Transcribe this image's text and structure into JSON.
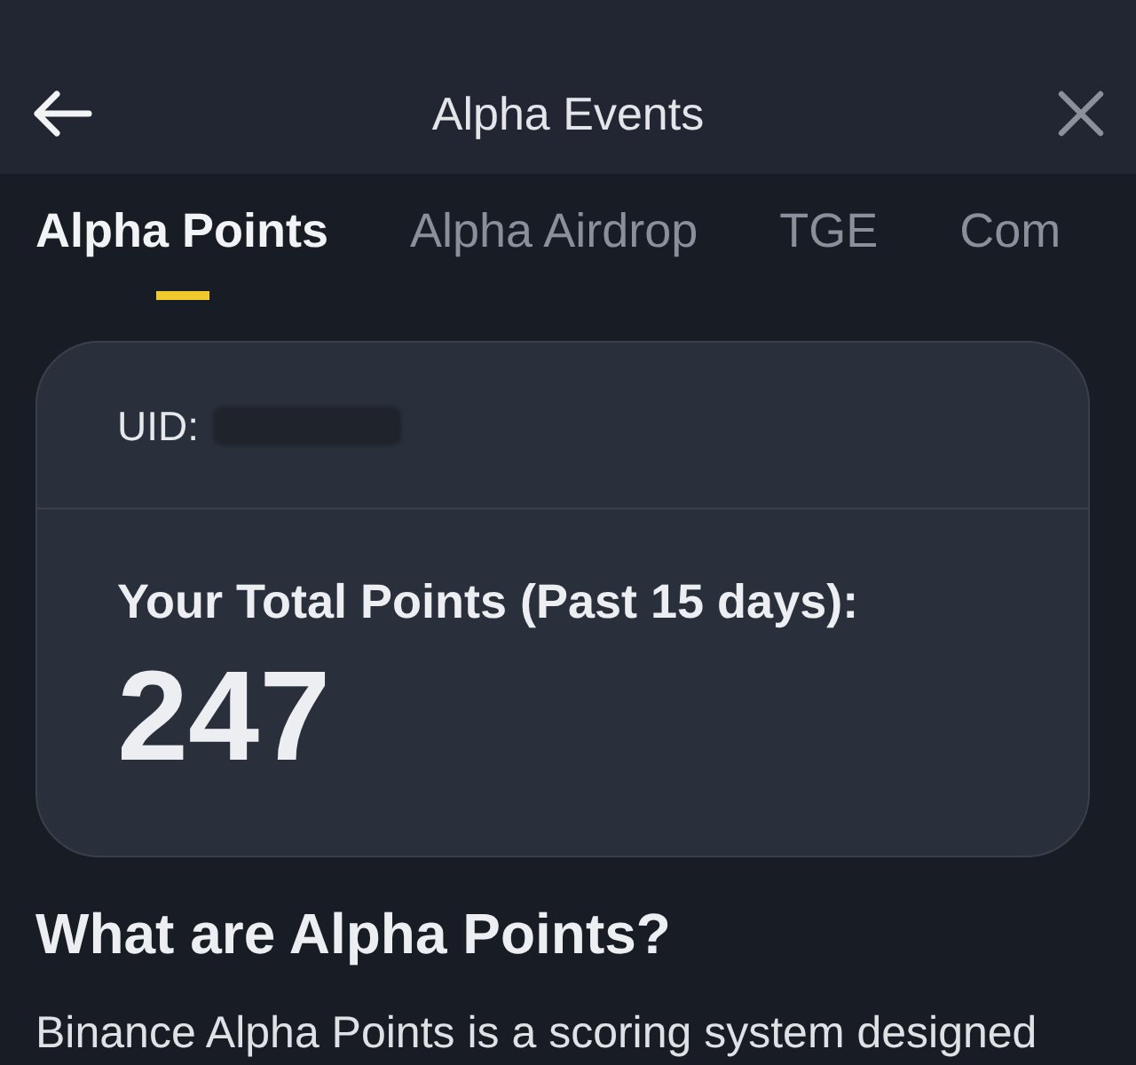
{
  "header": {
    "title": "Alpha Events"
  },
  "tabs": [
    {
      "label": "Alpha Points",
      "selected": true
    },
    {
      "label": "Alpha Airdrop",
      "selected": false
    },
    {
      "label": "TGE",
      "selected": false
    },
    {
      "label": "Com",
      "selected": false
    }
  ],
  "points_card": {
    "uid_label": "UID:",
    "uid_redacted": true,
    "total_label": "Your Total Points (Past 15 days):",
    "total_value": "247"
  },
  "section": {
    "heading": "What are Alpha Points?",
    "body": "Binance Alpha Points is a scoring system designed"
  }
}
